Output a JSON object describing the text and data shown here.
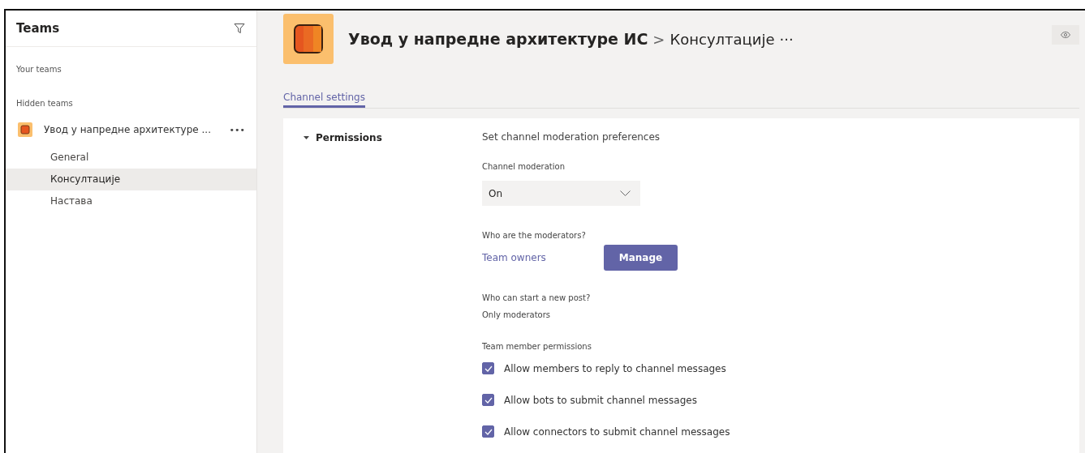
{
  "sidebar": {
    "title": "Teams",
    "sections": [
      {
        "label": "Your teams"
      },
      {
        "label": "Hidden teams"
      }
    ],
    "team": {
      "name": "Увод у напредне архитектуре ...",
      "more": "•••",
      "channels": [
        {
          "name": "General",
          "selected": false
        },
        {
          "name": "Консултације",
          "selected": true
        },
        {
          "name": "Настава",
          "selected": false
        }
      ]
    }
  },
  "header": {
    "team_name": "Увод у напредне архитектуре ИС",
    "separator": ">",
    "channel_name": "Консултације",
    "more": "···"
  },
  "tabs": [
    {
      "label": "Channel settings",
      "selected": true
    }
  ],
  "permissions": {
    "title": "Permissions",
    "expanded": true,
    "description": "Set channel moderation preferences",
    "moderation_label": "Channel moderation",
    "moderation_value": "On",
    "moderators_label": "Who are the moderators?",
    "moderators_value": "Team owners",
    "manage_button": "Manage",
    "post_label": "Who can start a new post?",
    "post_value": "Only moderators",
    "member_label": "Team member permissions",
    "options": [
      {
        "label": "Allow members to reply to channel messages",
        "checked": true
      },
      {
        "label": "Allow bots to submit channel messages",
        "checked": true
      },
      {
        "label": "Allow connectors to submit channel messages",
        "checked": true
      }
    ]
  }
}
